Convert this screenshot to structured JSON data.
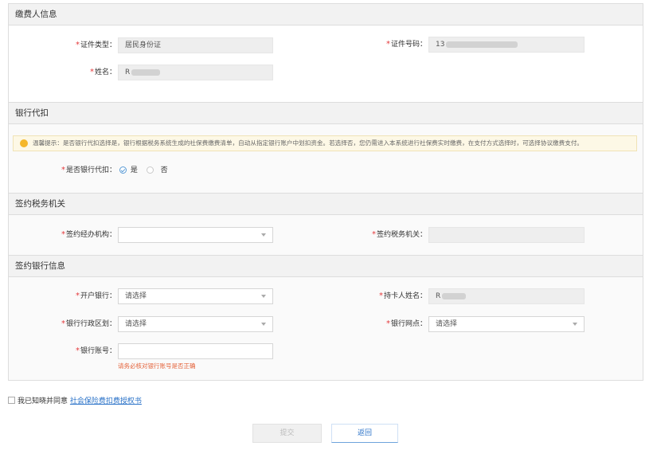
{
  "payer_info": {
    "title": "缴费人信息",
    "id_type_label": "证件类型：",
    "id_type_value": "居民身份证",
    "id_number_label": "证件号码：",
    "id_number_value": "13",
    "name_label": "姓名：",
    "name_value": "R"
  },
  "bank_deduction": {
    "title": "银行代扣",
    "notice": "温馨提示：是否银行代扣选择是，银行根据税务系统生成的社保费缴费清单，自动从指定银行账户中划扣资金。若选择否，您仍需进入本系统进行社保费实时缴费，在支付方式选择时，可选择协议缴费支付。",
    "question_label": "是否银行代扣：",
    "option_yes": "是",
    "option_no": "否"
  },
  "tax_authority": {
    "title": "签约税务机关",
    "agency_label": "签约经办机构：",
    "agency_value": "",
    "tax_office_label": "签约税务机关：",
    "tax_office_value": ""
  },
  "bank_info": {
    "title": "签约银行信息",
    "bank_label": "开户银行：",
    "bank_value": "请选择",
    "holder_label": "持卡人姓名：",
    "holder_value": "R",
    "region_label": "银行行政区划：",
    "region_value": "请选择",
    "branch_label": "银行网点：",
    "branch_value": "请选择",
    "account_label": "银行账号：",
    "account_value": "",
    "account_hint": "请务必核对银行账号是否正确"
  },
  "agreement": {
    "prefix": "我已知晓并同意",
    "link": "社会保险费扣费授权书"
  },
  "buttons": {
    "submit": "提交",
    "back": "返回"
  }
}
